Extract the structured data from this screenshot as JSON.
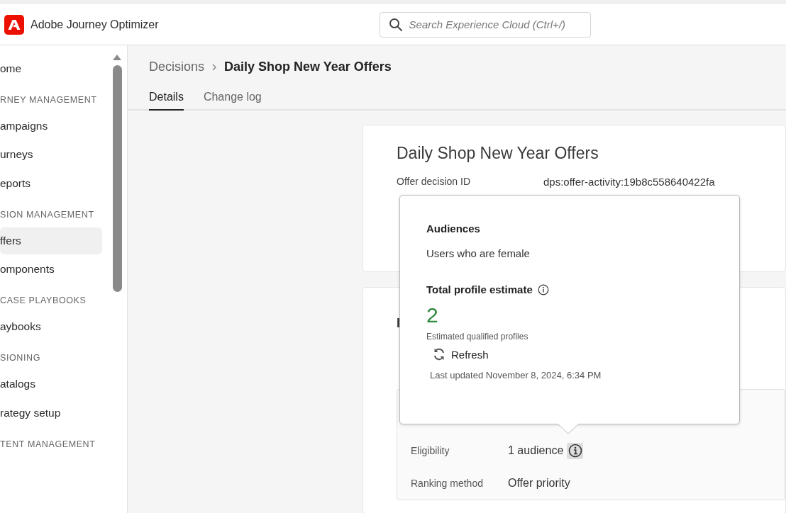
{
  "app": {
    "name": "Adobe Journey Optimizer"
  },
  "search": {
    "placeholder": "Search Experience Cloud (Ctrl+/)"
  },
  "sidebar": {
    "items": [
      {
        "kind": "item",
        "label": "ome",
        "selected": false
      },
      {
        "kind": "section",
        "label": "RNEY MANAGEMENT"
      },
      {
        "kind": "item",
        "label": "ampaigns",
        "selected": false
      },
      {
        "kind": "item",
        "label": "urneys",
        "selected": false
      },
      {
        "kind": "item",
        "label": "eports",
        "selected": false
      },
      {
        "kind": "section",
        "label": "SION MANAGEMENT"
      },
      {
        "kind": "item",
        "label": "ffers",
        "selected": true
      },
      {
        "kind": "item",
        "label": "omponents",
        "selected": false
      },
      {
        "kind": "section",
        "label": "CASE PLAYBOOKS"
      },
      {
        "kind": "item",
        "label": "aybooks",
        "selected": false
      },
      {
        "kind": "section",
        "label": "SIONING"
      },
      {
        "kind": "item",
        "label": "atalogs",
        "selected": false
      },
      {
        "kind": "item",
        "label": "rategy setup",
        "selected": false
      },
      {
        "kind": "section",
        "label": "TENT MANAGEMENT"
      }
    ]
  },
  "breadcrumb": {
    "parent": "Decisions",
    "current": "Daily Shop New Year Offers"
  },
  "tabs": [
    {
      "label": "Details",
      "selected": true
    },
    {
      "label": "Change log",
      "selected": false
    }
  ],
  "details_card": {
    "title": "Daily Shop New Year Offers",
    "rows": [
      {
        "label": "Offer decision ID",
        "value": "dps:offer-activity:19b8c558640422fa"
      }
    ]
  },
  "second_card": {
    "heading": "I",
    "rows": [
      {
        "kind": "info",
        "label": "Eligibility",
        "value": "1 audience"
      },
      {
        "kind": "plain",
        "label": "Ranking method",
        "value": "Offer priority"
      }
    ]
  },
  "popover": {
    "title": "Audiences",
    "audience": "Users who are female",
    "estimate_heading": "Total profile estimate",
    "count": "2",
    "caption": "Estimated qualified profiles",
    "refresh": "Refresh",
    "last_updated": "Last updated November 8, 2024, 6:34 PM"
  }
}
